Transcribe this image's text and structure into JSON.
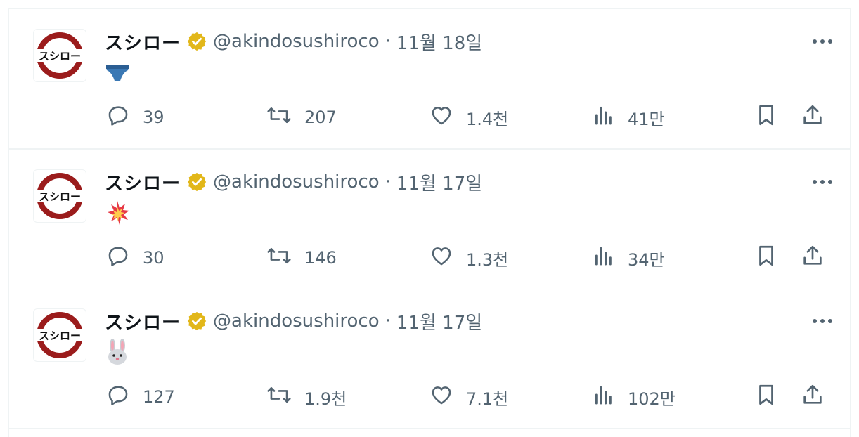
{
  "tweets": [
    {
      "name": "スシロー",
      "handle": "@akindosushiroco",
      "separator": "·",
      "date": "11월 18일",
      "content_icon": "briefs-emoji",
      "replies": "39",
      "retweets": "207",
      "likes": "1.4천",
      "views": "41만"
    },
    {
      "name": "スシロー",
      "handle": "@akindosushiroco",
      "separator": "·",
      "date": "11월 17일",
      "content_icon": "collision-emoji",
      "replies": "30",
      "retweets": "146",
      "likes": "1.3천",
      "views": "34만"
    },
    {
      "name": "スシロー",
      "handle": "@akindosushiroco",
      "separator": "·",
      "date": "11월 17일",
      "content_icon": "rabbit-face-emoji",
      "replies": "127",
      "retweets": "1.9천",
      "likes": "7.1천",
      "views": "102만"
    }
  ],
  "avatar_text": "スシロー",
  "colors": {
    "text": "#0f1419",
    "secondary": "#536471",
    "border": "#eff3f4",
    "verified_gold": "#e2b719",
    "avatar_ring": "#9b1c1c"
  }
}
